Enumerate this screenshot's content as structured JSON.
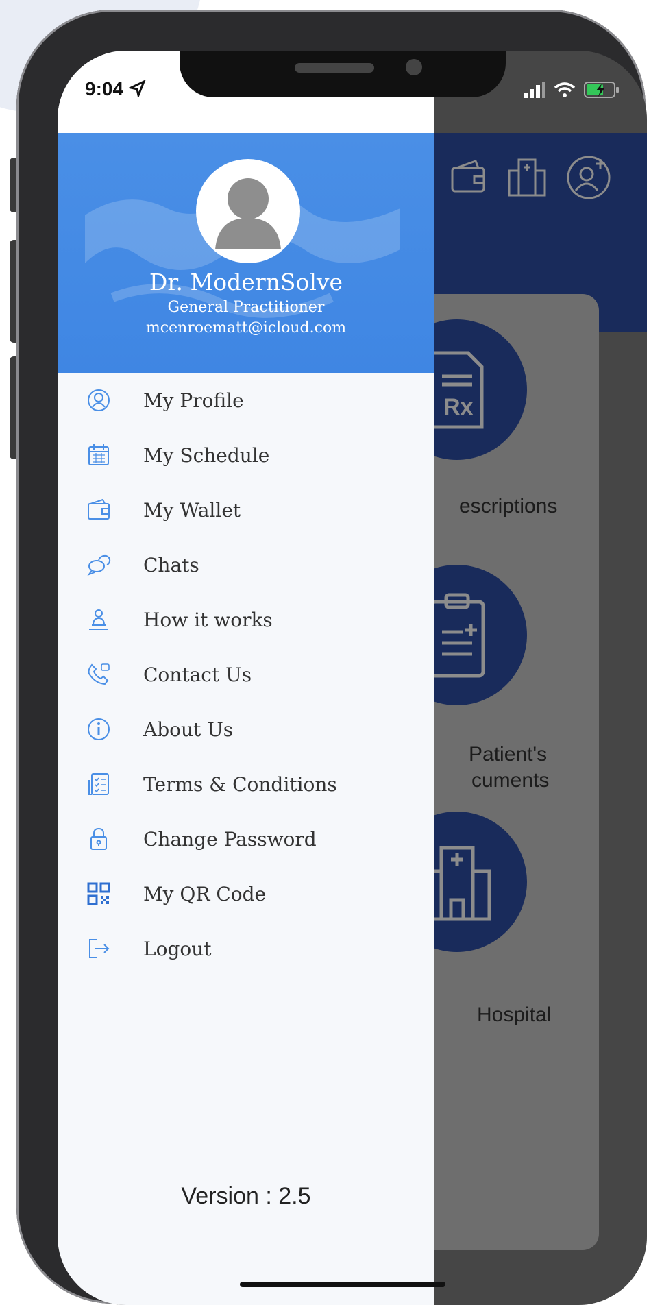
{
  "status_bar": {
    "time": "9:04"
  },
  "drawer": {
    "user": {
      "name": "Dr. ModernSolve",
      "role": "General Practitioner",
      "email": "mcenroematt@icloud.com"
    },
    "menu": [
      {
        "label": "My Profile",
        "icon": "profile-icon"
      },
      {
        "label": "My Schedule",
        "icon": "calendar-icon"
      },
      {
        "label": "My Wallet",
        "icon": "wallet-icon"
      },
      {
        "label": "Chats",
        "icon": "chat-icon"
      },
      {
        "label": "How it works",
        "icon": "how-it-works-icon"
      },
      {
        "label": "Contact Us",
        "icon": "phone-icon"
      },
      {
        "label": "About Us",
        "icon": "info-icon"
      },
      {
        "label": "Terms & Conditions",
        "icon": "checklist-icon"
      },
      {
        "label": "Change Password",
        "icon": "lock-icon"
      },
      {
        "label": "My QR Code",
        "icon": "qr-code-icon"
      },
      {
        "label": "Logout",
        "icon": "logout-icon"
      }
    ],
    "version": "Version : 2.5"
  },
  "background_app": {
    "tiles": [
      {
        "label": "escriptions"
      },
      {
        "label_line1": "Patient's",
        "label_line2": "cuments"
      },
      {
        "label": "Hospital"
      }
    ]
  },
  "colors": {
    "drawer_header": "#4a8fe6",
    "app_primary": "#2f4fa6",
    "menu_icon": "#4a8fe6"
  }
}
